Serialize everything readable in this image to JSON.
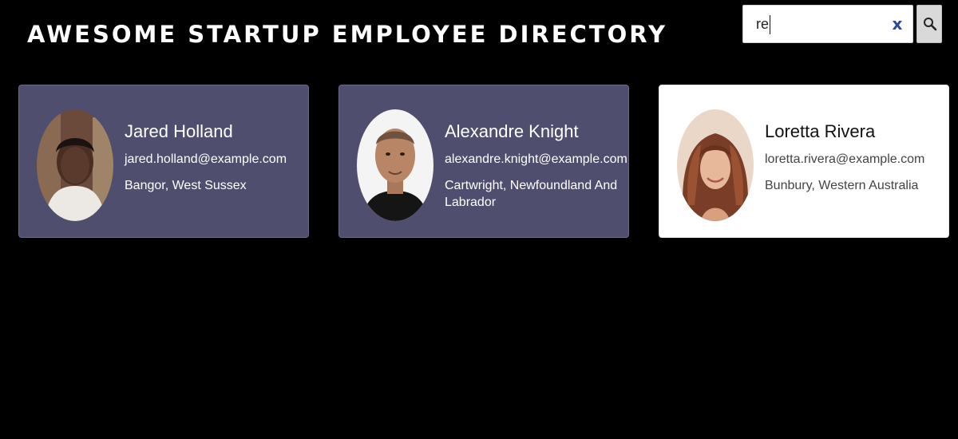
{
  "header": {
    "title": "AWESOME STARTUP EMPLOYEE DIRECTORY"
  },
  "search": {
    "value": "re",
    "clear_icon": "x-icon",
    "search_icon": "magnifier-icon",
    "clear_label": "x"
  },
  "employees": [
    {
      "name": "Jared Holland",
      "email": "jared.holland@example.com",
      "location": "Bangor, West Sussex",
      "avatar_icon": "avatar-photo"
    },
    {
      "name": "Alexandre Knight",
      "email": "alexandre.knight@example.com",
      "location": "Cartwright, Newfoundland And Labrador",
      "avatar_icon": "avatar-photo"
    },
    {
      "name": "Loretta Rivera",
      "email": "loretta.rivera@example.com",
      "location": "Bunbury, Western Australia",
      "avatar_icon": "avatar-photo",
      "selected": true
    }
  ],
  "colors": {
    "background": "#000000",
    "card": "#4f4e6e",
    "card_selected": "#ffffff",
    "clear_icon": "#2d4b8e"
  }
}
